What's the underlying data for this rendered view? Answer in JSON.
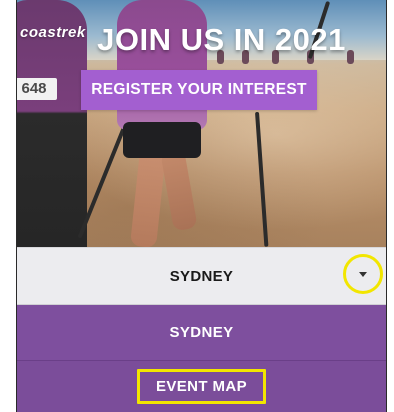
{
  "hero": {
    "title": "JOIN US IN 2021",
    "brand": "coastrek",
    "bib_number": "648",
    "register_label": "REGISTER YOUR INTEREST"
  },
  "location_select": {
    "selected": "SYDNEY",
    "caret_icon": "chevron-down-icon"
  },
  "menu": {
    "items": [
      {
        "label": "SYDNEY"
      },
      {
        "label": "EVENT MAP"
      }
    ]
  },
  "colors": {
    "accent": "#a35fd0",
    "menu_bg": "#7b4d9a",
    "highlight": "#f2e600"
  }
}
